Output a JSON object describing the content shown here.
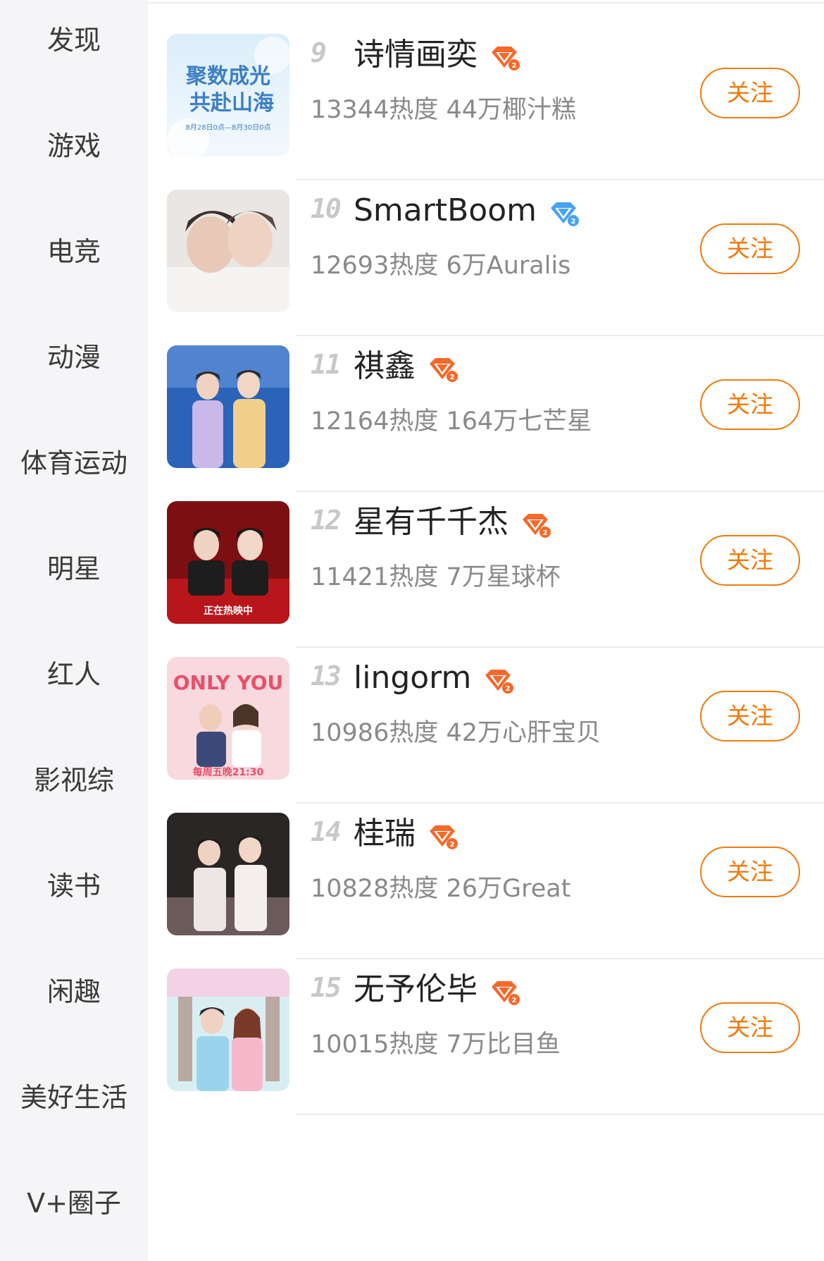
{
  "sidebar": {
    "items": [
      {
        "label": "发现"
      },
      {
        "label": "游戏"
      },
      {
        "label": "电竞"
      },
      {
        "label": "动漫"
      },
      {
        "label": "体育运动"
      },
      {
        "label": "明星"
      },
      {
        "label": "红人"
      },
      {
        "label": "影视综"
      },
      {
        "label": "读书"
      },
      {
        "label": "闲趣"
      },
      {
        "label": "美好生活"
      },
      {
        "label": "V+圈子"
      }
    ]
  },
  "list": {
    "follow_label": "关注",
    "rows": [
      {
        "rank": "9",
        "name": "诗情画奕",
        "heat": "13344热度",
        "fans": "44万椰汁糕",
        "badge": "orange-diamond-icon",
        "avatar_text": [
          "聚数成光",
          "共赴山海",
          "8月28日0点—8月30日0点"
        ]
      },
      {
        "rank": "10",
        "name": "SmartBoom",
        "heat": "12693热度",
        "fans": "6万Auralis",
        "badge": "blue-diamond-icon"
      },
      {
        "rank": "11",
        "name": "祺鑫",
        "heat": "12164热度",
        "fans": "164万七芒星",
        "badge": "orange-diamond-icon"
      },
      {
        "rank": "12",
        "name": "星有千千杰",
        "heat": "11421热度",
        "fans": "7万星球杯",
        "badge": "orange-diamond-icon",
        "avatar_text": [
          "正在热映中"
        ]
      },
      {
        "rank": "13",
        "name": "lingorm",
        "heat": "10986热度",
        "fans": "42万心肝宝贝",
        "badge": "orange-diamond-icon",
        "avatar_text": [
          "ONLY YOU",
          "每周五晚21:30"
        ]
      },
      {
        "rank": "14",
        "name": "桂瑞",
        "heat": "10828热度",
        "fans": "26万Great",
        "badge": "orange-diamond-icon"
      },
      {
        "rank": "15",
        "name": "无予伦毕",
        "heat": "10015热度",
        "fans": "7万比目鱼",
        "badge": "orange-diamond-icon"
      }
    ]
  },
  "colors": {
    "accent": "#f07b0e",
    "sidebar_bg": "#f5f5f7",
    "rank": "#c8c8c8",
    "meta": "#8a8a8a"
  }
}
